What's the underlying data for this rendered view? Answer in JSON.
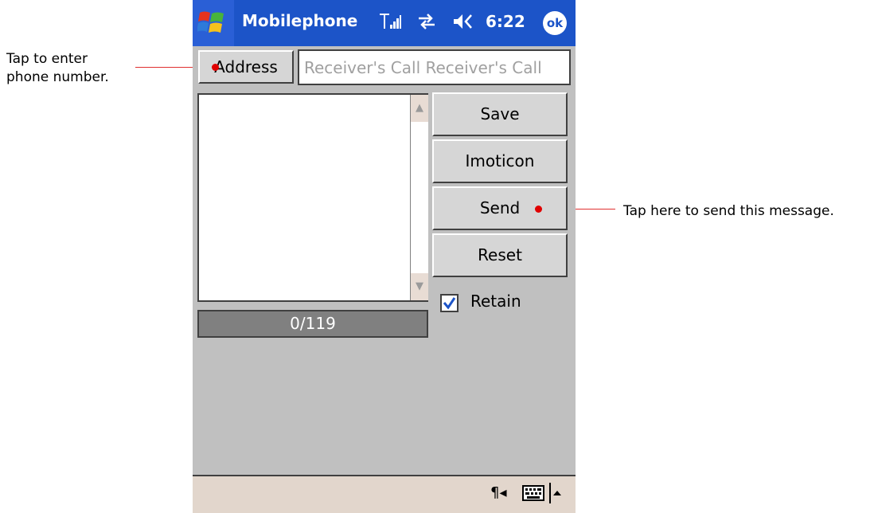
{
  "callouts": {
    "left_line1": "Tap to enter",
    "left_line2": "phone number.",
    "right": "Tap here to send this message."
  },
  "titlebar": {
    "app_title": "Mobilephone",
    "time": "6:22",
    "ok_label": "ok",
    "icons": [
      "windows-start-icon",
      "signal-icon",
      "sync-icon",
      "volume-icon"
    ]
  },
  "form": {
    "address_label": "Address",
    "receiver_placeholder": "Receiver's Call Receiver's Call",
    "counter": "0/119",
    "buttons": {
      "save": "Save",
      "imoticon": "Imoticon",
      "send": "Send",
      "reset": "Reset"
    },
    "retain_label": "Retain",
    "retain_checked": true
  },
  "colors": {
    "titlebar": "#1c54c8",
    "callout": "#e00000"
  }
}
